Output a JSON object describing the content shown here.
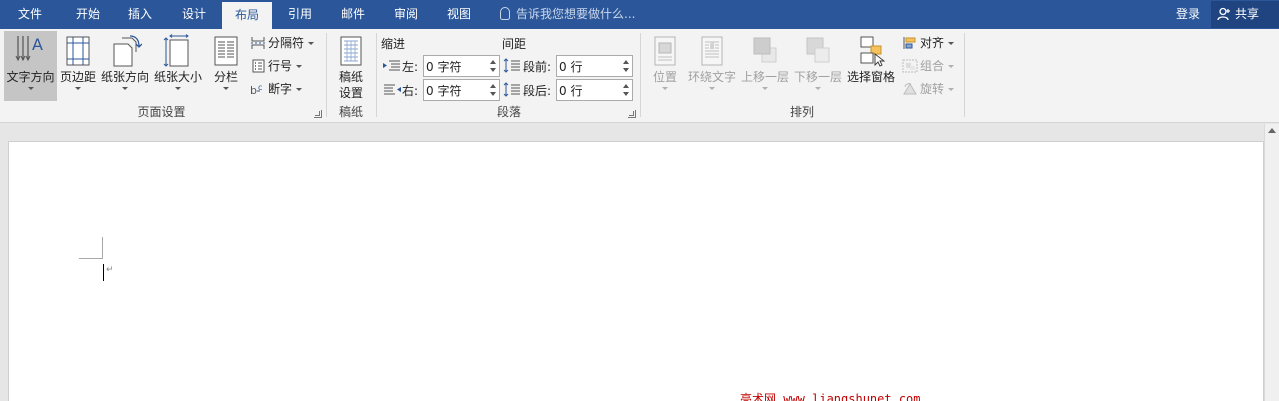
{
  "tabs": [
    {
      "label": "文件",
      "active": false
    },
    {
      "label": "开始",
      "active": false
    },
    {
      "label": "插入",
      "active": false
    },
    {
      "label": "设计",
      "active": false
    },
    {
      "label": "布局",
      "active": true
    },
    {
      "label": "引用",
      "active": false
    },
    {
      "label": "邮件",
      "active": false
    },
    {
      "label": "审阅",
      "active": false
    },
    {
      "label": "视图",
      "active": false
    }
  ],
  "tell_me": "告诉我您想要做什么...",
  "account": {
    "login": "登录",
    "share": "共享"
  },
  "page_setup": {
    "group_label": "页面设置",
    "text_direction": "文字方向",
    "margins": "页边距",
    "orientation": "纸张方向",
    "size": "纸张大小",
    "columns": "分栏",
    "breaks": "分隔符",
    "line_numbers": "行号",
    "hyphenation": "断字"
  },
  "draft_paper": {
    "group_label": "稿纸",
    "setup_line1": "稿纸",
    "setup_line2": "设置"
  },
  "paragraph": {
    "group_label": "段落",
    "indent_label": "缩进",
    "spacing_label": "间距",
    "indent_left_label": "左:",
    "indent_left_value": "0 字符",
    "indent_right_label": "右:",
    "indent_right_value": "0 字符",
    "before_label": "段前:",
    "before_value": "0 行",
    "after_label": "段后:",
    "after_value": "0 行"
  },
  "arrange": {
    "group_label": "排列",
    "position": "位置",
    "wrap_text": "环绕文字",
    "bring_forward": "上移一层",
    "send_backward": "下移一层",
    "selection_pane": "选择窗格",
    "align": "对齐",
    "group": "组合",
    "rotate": "旋转"
  },
  "watermark": "亮术网 www.liangshunet.com",
  "colors": {
    "accent": "#2b579a",
    "ribbon_bg": "#f3f3f3",
    "watermark": "#c00000"
  }
}
